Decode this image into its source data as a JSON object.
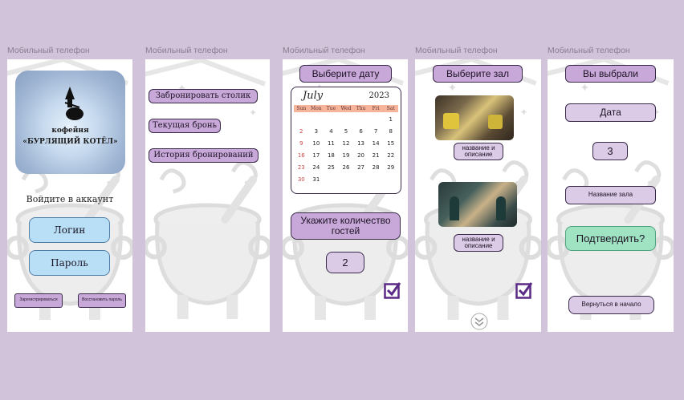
{
  "labels": {
    "s1": "Мобильный телефон",
    "s2": "Мобильный телефон",
    "s3": "Мобильный телефон",
    "s4": "Мобильный телефон",
    "s5": "Мобильный телефон"
  },
  "login": {
    "logo_line1": "кофейня",
    "logo_line2": "«БУРЛЯЩИЙ КОТЁЛ»",
    "heading": "Войдите в аккаунт",
    "login_button": "Логин",
    "password_button": "Пароль",
    "register_button": "Зарегистрироваться",
    "restore_button": "Восстановить пароль"
  },
  "menu": {
    "items": [
      "Забронировать столик",
      "Текущая бронь",
      "История бронирований"
    ]
  },
  "date": {
    "title": "Выберите дату",
    "calendar": {
      "month": "July",
      "year": "2023",
      "days": [
        "Sun",
        "Mon",
        "Tue",
        "Wed",
        "Thu",
        "Fri",
        "Sat"
      ],
      "cells": [
        "",
        "",
        "",
        "",
        "",
        "",
        "1",
        "2",
        "3",
        "4",
        "5",
        "6",
        "7",
        "8",
        "9",
        "10",
        "11",
        "12",
        "13",
        "14",
        "15",
        "16",
        "17",
        "18",
        "19",
        "20",
        "21",
        "22",
        "23",
        "24",
        "25",
        "26",
        "27",
        "28",
        "29",
        "30",
        "31",
        "",
        "",
        "",
        "",
        ""
      ]
    },
    "guests_label": "Укажите количество гостей",
    "guests_value": "2"
  },
  "hall": {
    "title": "Выберите зал",
    "card1": "название и описание",
    "card2": "название и описание"
  },
  "summary": {
    "title": "Вы выбрали",
    "date": "Дата",
    "count": "3",
    "hall": "Название зала",
    "confirm": "Подтвердить?",
    "back": "Вернуться в начало"
  },
  "colors": {
    "accent": "#c8a8d9",
    "check": "#5b2a86",
    "confirm": "#9fe3c2",
    "login_buttons": "#b9dff7"
  }
}
